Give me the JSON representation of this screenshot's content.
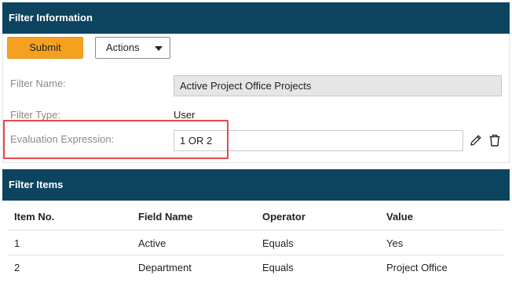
{
  "filter_info": {
    "header": "Filter Information",
    "submit_label": "Submit",
    "actions_label": "Actions",
    "name_label": "Filter Name:",
    "name_value": "Active Project Office Projects",
    "type_label": "Filter Type:",
    "type_value": "User",
    "eval_label": "Evaluation Expression:",
    "eval_value": "1 OR 2",
    "icons": {
      "edit": "pencil-icon",
      "delete": "trash-icon"
    },
    "highlight_color": "#e5484d"
  },
  "filter_items": {
    "header": "Filter Items",
    "columns": [
      "Item No.",
      "Field Name",
      "Operator",
      "Value"
    ],
    "rows": [
      [
        "1",
        "Active",
        "Equals",
        "Yes"
      ],
      [
        "2",
        "Department",
        "Equals",
        "Project Office"
      ]
    ]
  },
  "colors": {
    "header_bg": "#0c4460",
    "submit_bg": "#f5a11f"
  }
}
